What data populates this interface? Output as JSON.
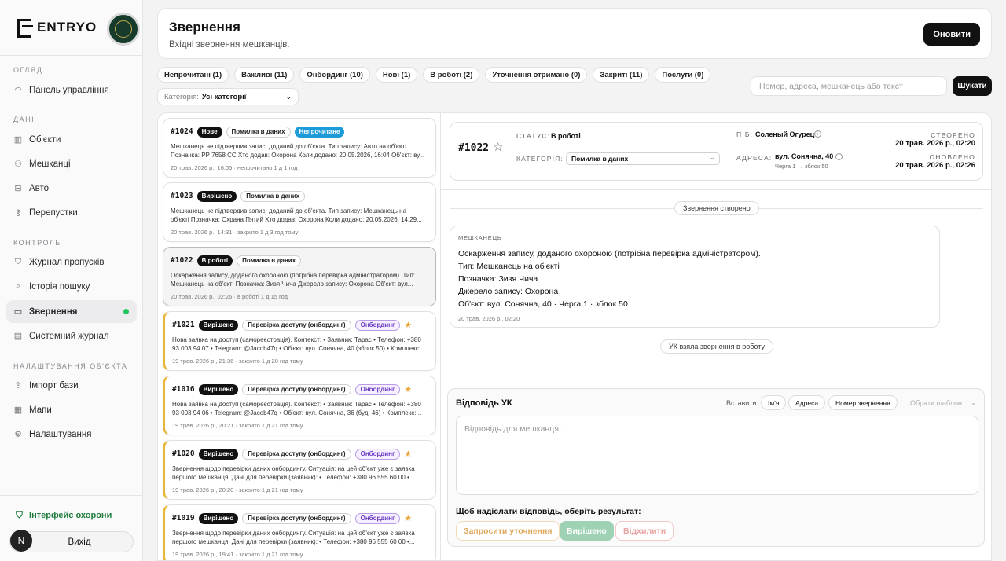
{
  "brand": {
    "name": "ENTRYO"
  },
  "sidebar": {
    "sections": [
      {
        "title": "ОГЛЯД",
        "items": [
          {
            "label": "Панель управління",
            "icon": "gauge-icon"
          }
        ]
      },
      {
        "title": "ДАНІ",
        "items": [
          {
            "label": "Об'єкти",
            "icon": "building-icon"
          },
          {
            "label": "Мешканці",
            "icon": "users-icon"
          },
          {
            "label": "Авто",
            "icon": "car-icon"
          },
          {
            "label": "Перепустки",
            "icon": "key-icon"
          }
        ]
      },
      {
        "title": "КОНТРОЛЬ",
        "items": [
          {
            "label": "Журнал пропусків",
            "icon": "shield-icon"
          },
          {
            "label": "Історія пошуку",
            "icon": "search-icon"
          },
          {
            "label": "Звернення",
            "icon": "message-icon",
            "active": true
          },
          {
            "label": "Системний журнал",
            "icon": "document-icon"
          }
        ]
      },
      {
        "title": "НАЛАШТУВАННЯ ОБ'ЄКТА",
        "items": [
          {
            "label": "Імпорт бази",
            "icon": "upload-icon"
          },
          {
            "label": "Мапи",
            "icon": "map-icon"
          },
          {
            "label": "Налаштування",
            "icon": "gear-icon"
          }
        ]
      }
    ],
    "guard_interface": "Інтерфейс охорони",
    "avatar_letter": "N",
    "logout": "Вихід"
  },
  "header": {
    "title": "Звернення",
    "subtitle": "Вхідні звернення мешканців.",
    "refresh": "Оновити"
  },
  "tabs": [
    "Непрочитані (1)",
    "Важливі (11)",
    "Онбординг (10)",
    "Нові (1)",
    "В роботі (2)",
    "Уточнення отримано (0)",
    "Закриті (11)",
    "Послуги (0)"
  ],
  "search": {
    "placeholder": "Номер, адреса, мешканець або текст",
    "button": "Шукати"
  },
  "category_filter": {
    "label": "Категорія:",
    "value": "Усі категорії"
  },
  "tickets": [
    {
      "num": "#1024",
      "badges": [
        [
          "Нове",
          "dark"
        ],
        [
          "Помилка в даних",
          "outline"
        ],
        [
          "Непрочитане",
          "blue"
        ]
      ],
      "star": false,
      "onb": false,
      "selected": false,
      "line1": "Мешканець не підтвердив запис, доданий до об'єкта. Тип запису: Авто на об'єкті",
      "line2": "Позначка: РР 7658 СС Хто додав: Охорона Коли додано: 20.05.2026, 16:04 Об'єкт: ву...",
      "meta": "20 трав. 2026 р., 16:05 · непрочитано 1 д 1 год"
    },
    {
      "num": "#1023",
      "badges": [
        [
          "Вирішено",
          "dark"
        ],
        [
          "Помилка в даних",
          "outline"
        ]
      ],
      "star": false,
      "onb": false,
      "selected": false,
      "line1": "Мешканець не підтвердив запис, доданий до об'єкта. Тип запису: Мешканець на",
      "line2": "об'єкті Позначка: Охрана Пятий Хто додав: Охорона Коли додано: 20.05.2026, 14:29...",
      "meta": "20 трав. 2026 р., 14:31 · закрито 1 д 3 год тому"
    },
    {
      "num": "#1022",
      "badges": [
        [
          "В роботі",
          "dark"
        ],
        [
          "Помилка в даних",
          "outline"
        ]
      ],
      "star": false,
      "onb": false,
      "selected": true,
      "line1": "Оскарження запису, доданого охороною (потрібна перевірка адміністратором). Тип:",
      "line2": "Мешканець на об'єкті Позначка: Зизя Чича Джерело запису: Охорона Об'єкт: вул...",
      "meta": "20 трав. 2026 р., 02:26 · в роботі 1 д 15 год"
    },
    {
      "num": "#1021",
      "badges": [
        [
          "Вирішено",
          "dark"
        ],
        [
          "Перевірка доступу (онбординг)",
          "outline"
        ],
        [
          "Онбординг",
          "purple"
        ]
      ],
      "star": true,
      "onb": true,
      "selected": false,
      "line1": "Нова заявка на доступ (самореєстрація). Контекст: • Заявник: Тарас • Телефон: +380",
      "line2": "93 003 94 07 • Telegram: @Jacob47q • Об'єкт: вул. Сонячна, 40 (зблок 50) • Комплекс:...",
      "meta": "19 трав. 2026 р., 21:36 · закрито 1 д 20 год тому"
    },
    {
      "num": "#1016",
      "badges": [
        [
          "Вирішено",
          "dark"
        ],
        [
          "Перевірка доступу (онбординг)",
          "outline"
        ],
        [
          "Онбординг",
          "purple"
        ]
      ],
      "star": true,
      "onb": true,
      "selected": false,
      "line1": "Нова заявка на доступ (самореєстрація). Контекст: • Заявник: Тарас • Телефон: +380",
      "line2": "93 003 94 06 • Telegram: @Jacob47q • Об'єкт: вул. Сонячна, 36 (буд. 46) • Комплекс:...",
      "meta": "19 трав. 2026 р., 20:21 · закрито 1 д 21 год тому"
    },
    {
      "num": "#1020",
      "badges": [
        [
          "Вирішено",
          "dark"
        ],
        [
          "Перевірка доступу (онбординг)",
          "outline"
        ],
        [
          "Онбординг",
          "purple"
        ]
      ],
      "star": true,
      "onb": true,
      "selected": false,
      "line1": "Звернення щодо перевірки даних онбордингу. Ситуація: на цей об'єкт уже є заявка",
      "line2": "першого мешканця. Дані для перевірки (заявник): • Телефон: +380 96 555 60 00 •...",
      "meta": "19 трав. 2026 р., 20:20 · закрито 1 д 21 год тому"
    },
    {
      "num": "#1019",
      "badges": [
        [
          "Вирішено",
          "dark"
        ],
        [
          "Перевірка доступу (онбординг)",
          "outline"
        ],
        [
          "Онбординг",
          "purple"
        ]
      ],
      "star": true,
      "onb": true,
      "selected": false,
      "line1": "Звернення щодо перевірки даних онбордингу. Ситуація: на цей об'єкт уже є заявка",
      "line2": "першого мешканця. Дані для перевірки (заявник): • Телефон: +380 96 555 60 00 •...",
      "meta": "19 трав. 2026 р., 19:41 · закрито 1 д 21 год тому"
    }
  ],
  "detail": {
    "num": "#1022",
    "status_label": "СТАТУС:",
    "status": "В роботі",
    "category_label": "КАТЕГОРІЯ:",
    "category": "Помилка в даних",
    "name_label": "ПІБ:",
    "name": "Соленый Огурец",
    "address_label": "АДРЕСА:",
    "address": "вул. Сонячна, 40",
    "address_sub": "Черга 1 → зблок 50",
    "created_label": "СТВОРЕНО",
    "created": "20 трав. 2026 р., 02:20",
    "updated_label": "ОНОВЛЕНО",
    "updated": "20 трав. 2026 р., 02:26",
    "event1": "Звернення створено",
    "event2": "УК взяла звернення в роботу",
    "message": {
      "author": "МЕШКАНЕЦЬ",
      "lines": [
        "Оскарження запису, доданого охороною (потрібна перевірка адміністратором).",
        "Тип: Мешканець на об'єкті",
        "Позначка: Зизя Чича",
        "Джерело запису: Охорона",
        "Об'єкт: вул. Сонячна, 40 · Черга 1 · зблок 50"
      ],
      "date": "20 трав. 2026 р., 02:20"
    }
  },
  "reply": {
    "title": "Відповідь УК",
    "insert": "Вставити",
    "chips": [
      "Ім'я",
      "Адреса",
      "Номер звернення"
    ],
    "template": "Обрати шаблон",
    "placeholder": "Відповідь для мешканця...",
    "result_label": "Щоб надіслати відповідь, оберіть результат:",
    "clarify": "Запросити уточнення",
    "done": "Вирішено",
    "reject": "Відхилити"
  }
}
